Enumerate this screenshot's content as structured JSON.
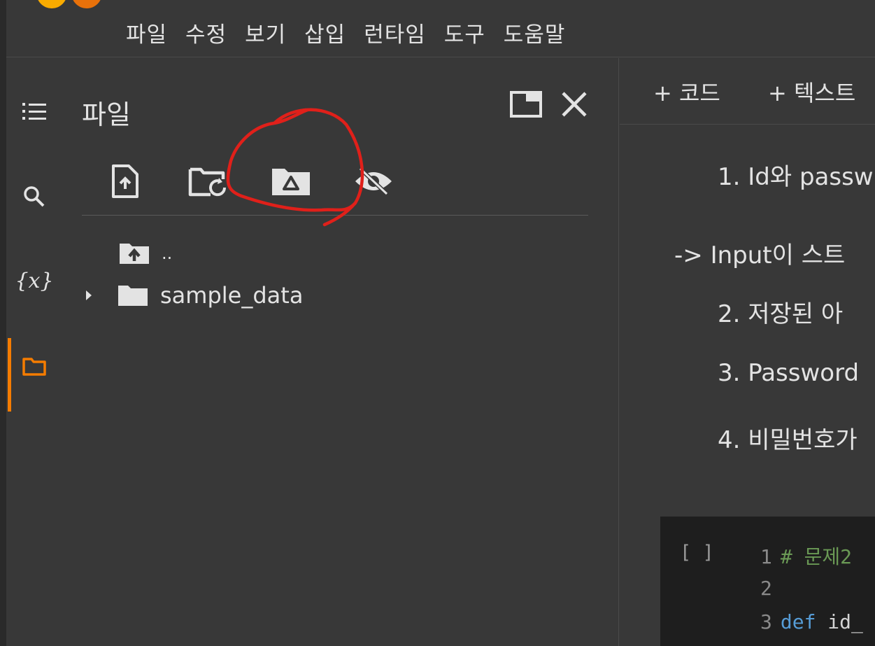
{
  "menu": [
    "파일",
    "수정",
    "보기",
    "삽입",
    "런타임",
    "도구",
    "도움말"
  ],
  "sidebar": {
    "icons": [
      "table-of-contents-icon",
      "search-icon",
      "variables-icon",
      "files-icon"
    ],
    "variables_label": "{x}"
  },
  "files_panel": {
    "title": "파일",
    "toolbar": [
      "upload-file-icon",
      "refresh-folder-icon",
      "mount-drive-icon",
      "hide-files-icon"
    ],
    "items": [
      {
        "name": "..",
        "type": "parent"
      },
      {
        "name": "sample_data",
        "type": "folder"
      }
    ]
  },
  "notebook": {
    "toolbar": {
      "add_code": "+ 코드",
      "add_text": "+ 텍스트"
    },
    "markdown_lines": [
      "1. Id와 passw",
      "-> Input이 스트",
      "2. 저장된 아",
      "3. Password",
      "4. 비밀번호가"
    ],
    "code_cell": {
      "bracket": "[ ]",
      "lines": [
        {
          "num": "1",
          "parts": [
            {
              "t": "# 문제2",
              "c": "comment"
            }
          ]
        },
        {
          "num": "2",
          "parts": []
        },
        {
          "num": "3",
          "parts": [
            {
              "t": "def",
              "c": "kw"
            },
            {
              "t": " id_",
              "c": "plain"
            }
          ]
        }
      ]
    }
  },
  "colors": {
    "accent": "#f57c00",
    "annotation": "#e0201a"
  }
}
